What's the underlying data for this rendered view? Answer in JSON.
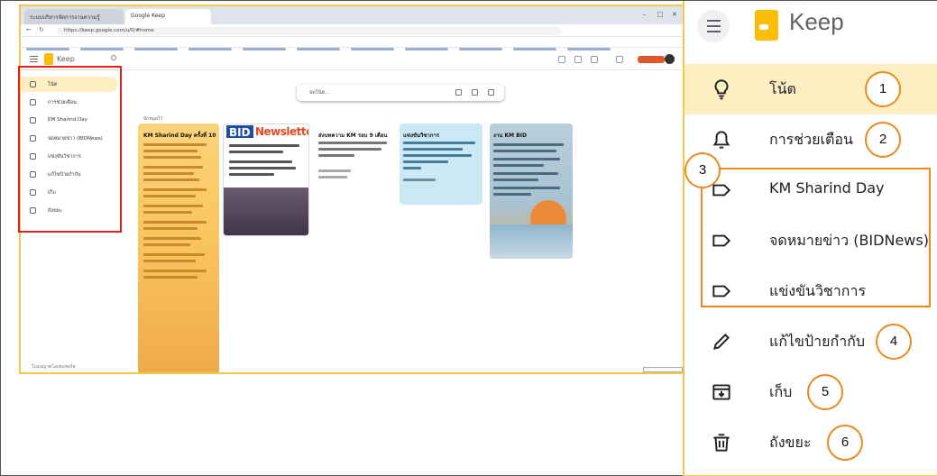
{
  "browser": {
    "tabs": [
      "ระบบบริหารจัดการงานความรู้",
      "Google Keep"
    ],
    "url": "https://keep.google.com/u/0/#home",
    "app_name": "Keep"
  },
  "keep_panel": {
    "app_title": "Keep",
    "nav": [
      {
        "label": "โน้ต",
        "badge": "1",
        "icon": "lightbulb-icon",
        "active": true
      },
      {
        "label": "การช่วยเตือน",
        "badge": "2",
        "icon": "bell-icon",
        "active": false
      },
      {
        "label": "KM Sharind Day",
        "icon": "label-icon",
        "active": false
      },
      {
        "label": "จดหมายข่าว (BIDNews)",
        "icon": "label-icon",
        "active": false
      },
      {
        "label": "แข่งขันวิชาการ",
        "icon": "label-icon",
        "active": false
      },
      {
        "label": "แก้ไขป้ายกำกับ",
        "badge": "4",
        "icon": "pencil-icon",
        "active": false
      },
      {
        "label": "เก็บ",
        "badge": "5",
        "icon": "archive-icon",
        "active": false
      },
      {
        "label": "ถังขยะ",
        "badge": "6",
        "icon": "trash-icon",
        "active": false
      }
    ],
    "group_badge": "3"
  },
  "mini_sidebar": {
    "items": [
      "โน้ต",
      "การช่วยเตือน",
      "KM Sharind Day",
      "จดหมายข่าว (BIDNews)",
      "แข่งขันวิชาการ",
      "แก้ไขป้ายกำกับ",
      "เก็บ",
      "ถังขยะ"
    ],
    "footer": "ใบอนุญาตโอเพนซอร์ส"
  },
  "take_note": {
    "placeholder": "จดโน้ต..."
  },
  "pinned_label": "ปักหมุดไว้",
  "cards": {
    "c1_title": "KM Sharind Day ครั้งที่ 10",
    "c2_bid": "BID",
    "c2_news": "Newsletter",
    "c3_title": "ส่งบทความ KM รอบ 9 เดือน",
    "c4_title": "แข่งขันวิชาการ",
    "c5_title": "งาน KM BID"
  },
  "colors": {
    "accent": "#ea8a1f",
    "active_bg": "#feefc3",
    "highlight_red": "#e0201a",
    "keep_yellow": "#fbbc04",
    "frame_yellow": "#f2c94c"
  }
}
